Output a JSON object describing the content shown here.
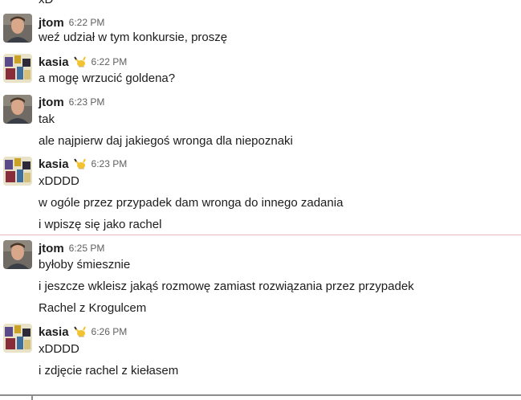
{
  "cutoff_text": "xD",
  "messages": [
    {
      "author": "jtom",
      "time": "6:22 PM",
      "lines": [
        "weź udział w tym konkursie, proszę"
      ]
    },
    {
      "author": "kasia",
      "time": "6:22 PM",
      "lines": [
        "a mogę wrzucić goldena?"
      ]
    },
    {
      "author": "jtom",
      "time": "6:23 PM",
      "lines": [
        "tak",
        "ale najpierw daj jakiegoś wronga dla niepoznaki"
      ]
    },
    {
      "author": "kasia",
      "time": "6:23 PM",
      "lines": [
        "xDDDD",
        "w ogóle przez przypadek dam wronga do innego zadania",
        "i wpiszę się jako rachel"
      ]
    },
    {
      "author": "jtom",
      "time": "6:25 PM",
      "lines": [
        "byłoby śmiesznie",
        "i jeszcze wkleisz jakąś rozmowę zamiast rozwiązania przez przypadek",
        "Rachel z Krogulcem"
      ]
    },
    {
      "author": "kasia",
      "time": "6:26 PM",
      "lines": [
        "xDDDD",
        "i zdjęcie rachel z kiełasem"
      ]
    }
  ],
  "icons": {
    "status": "pikachu-status-icon",
    "avatar_jtom": "avatar-jtom",
    "avatar_kasia": "avatar-kasia"
  },
  "colors": {
    "text": "#1d1c1d",
    "timestamp": "#616061",
    "new_divider": "#e8b7b7"
  }
}
